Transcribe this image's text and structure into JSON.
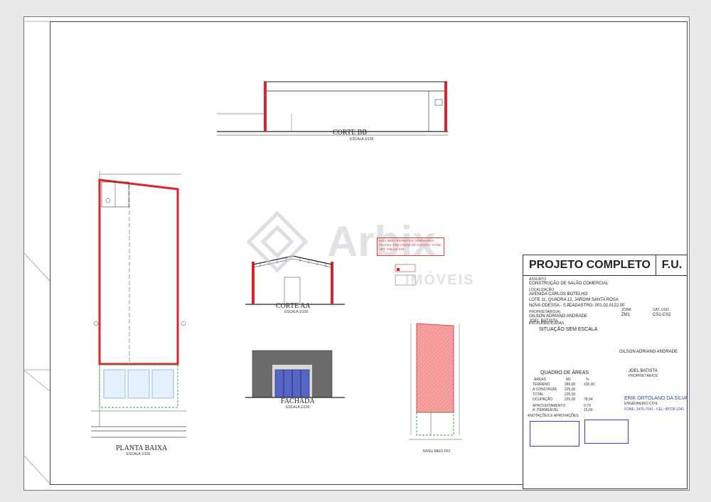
{
  "watermark": {
    "brand": "Arbix",
    "sub": "IMÓVEIS"
  },
  "drawings": {
    "corte_bb": {
      "title": "CORTE BB",
      "scale": "ESCALA 1/100"
    },
    "corte_aa": {
      "title": "CORTE AA",
      "scale": "ESCALA 1/100"
    },
    "fachada": {
      "title": "FACHADA",
      "scale": "ESCALA 1/100"
    },
    "planta_baixa": {
      "title": "PLANTA BAIXA",
      "scale": "ESCALA 1/100"
    },
    "note": "NÃO SERÁ PERMITIDO DRENAGEM PLUVIAL PELA REDE DE ESGOTO, CONF. ART. 235 LEI 122",
    "nivel_label": "NIVEL MEIO FIO"
  },
  "title_block": {
    "title": "PROJETO COMPLETO",
    "code": "F.U.",
    "assunto_label": "ASSUNTO",
    "assunto": "CONSTRUÇÃO DE SALÃO COMERCIAL",
    "local_label": "LOCALIZAÇÃO",
    "endereco": "AVENIDA CARLOS BOTELHO",
    "lote": "LOTE 11, QUADRA 12, JARDIM SANTA ROSA",
    "cidade": "NOVA ODESSA - S.P.",
    "cadastro": "CADASTRO: 001.02.0122.00",
    "zona_label": "ZONA",
    "zona": "ZM1",
    "cat_label": "CAT. USO",
    "cat": "CS1-CS2",
    "prop_label": "PROPRIETARIO(A)",
    "prop1": "GILSON ADRIANO ANDRADE",
    "prop2": "JOEL BATISTA",
    "escalas": "ESCALAS",
    "indicadas": "INDICADAS",
    "situacao": "SITUAÇÃO SEM ESCALA",
    "quadro": "QUADRO DE ÁREAS",
    "area_headers": [
      "ÁREAS",
      "M2",
      "%"
    ],
    "area_rows": [
      [
        "TERRENO",
        "285,00",
        "100,00"
      ],
      [
        "A CONSTRUIR",
        "225,00",
        ""
      ],
      [
        "TOTAL",
        "225,00",
        ""
      ],
      [
        "OCUPAÇÃO",
        "225,00",
        "78,94"
      ]
    ],
    "aproveitamento": [
      "APROVEITAMENTO",
      "0,79"
    ],
    "permeavel": [
      "A. PERMEÁVEL",
      "15,00"
    ],
    "sign1": "GILSON ADRIANO ANDRADE",
    "sign2": "JOEL BATISTA",
    "proprietarios": "PROPRIETÁRIOS",
    "resp": "ERIK ORTOLANO DA SILVA",
    "resp_role": "ENGENHEIRO CIVIL",
    "fone": "FONE: 3476-7041 - CEL: 98728-1041",
    "anotacoes": "ANOTAÇÕES E APROVAÇÕES"
  },
  "colors": {
    "wall_red": "#d9262b",
    "hatch_red": "#f28b8b",
    "green": "#2e9e3a",
    "blue": "#3b3bd6",
    "gray_facade": "#6b6b6b",
    "glass": "#5566c8"
  }
}
